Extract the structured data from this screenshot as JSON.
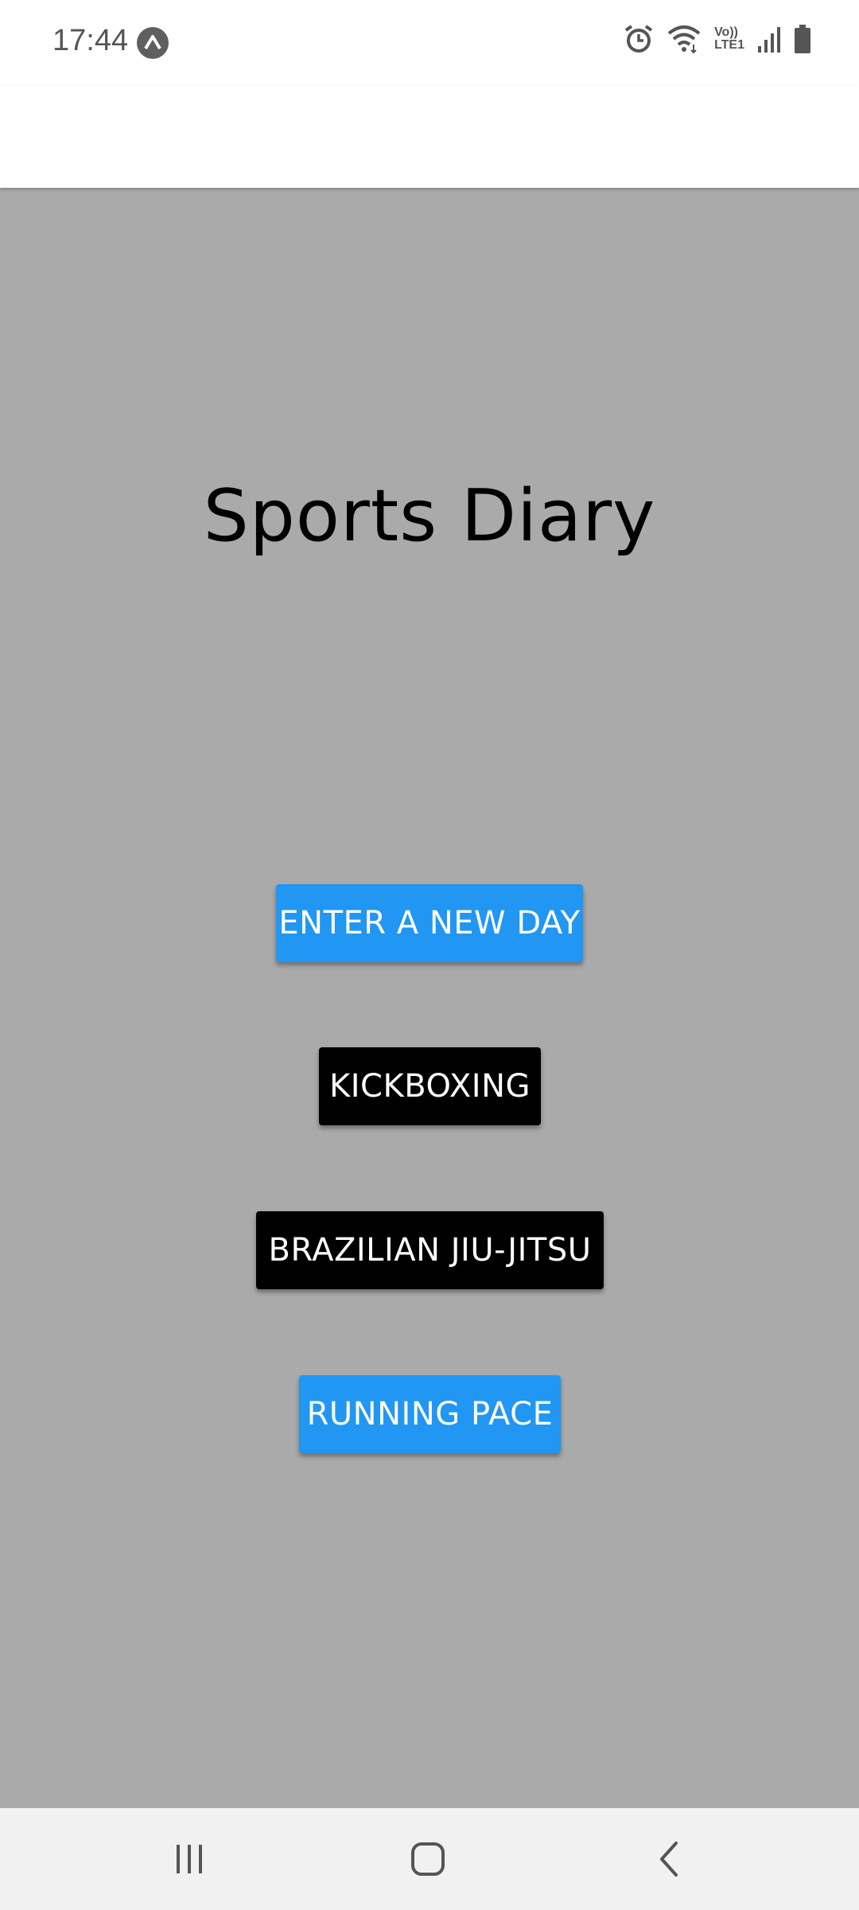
{
  "status_bar": {
    "time": "17:44",
    "icons": [
      "expo-icon",
      "alarm-icon",
      "wifi-icon",
      "volte-icon",
      "signal-icon",
      "battery-icon"
    ],
    "volte_text_top": "Vo))",
    "volte_text_bottom": "LTE1"
  },
  "main": {
    "background": "#aaaaaa",
    "title": "Sports Diary",
    "buttons": [
      {
        "label": "ENTER A NEW DAY",
        "color": "#2196F3"
      },
      {
        "label": "KICKBOXING",
        "color": "#000000"
      },
      {
        "label": "BRAZILIAN JIU-JITSU",
        "color": "#000000"
      },
      {
        "label": "RUNNING PACE",
        "color": "#2196F3"
      }
    ]
  },
  "nav_bar": {
    "icons": [
      "recent-apps-icon",
      "home-icon",
      "back-icon"
    ]
  }
}
